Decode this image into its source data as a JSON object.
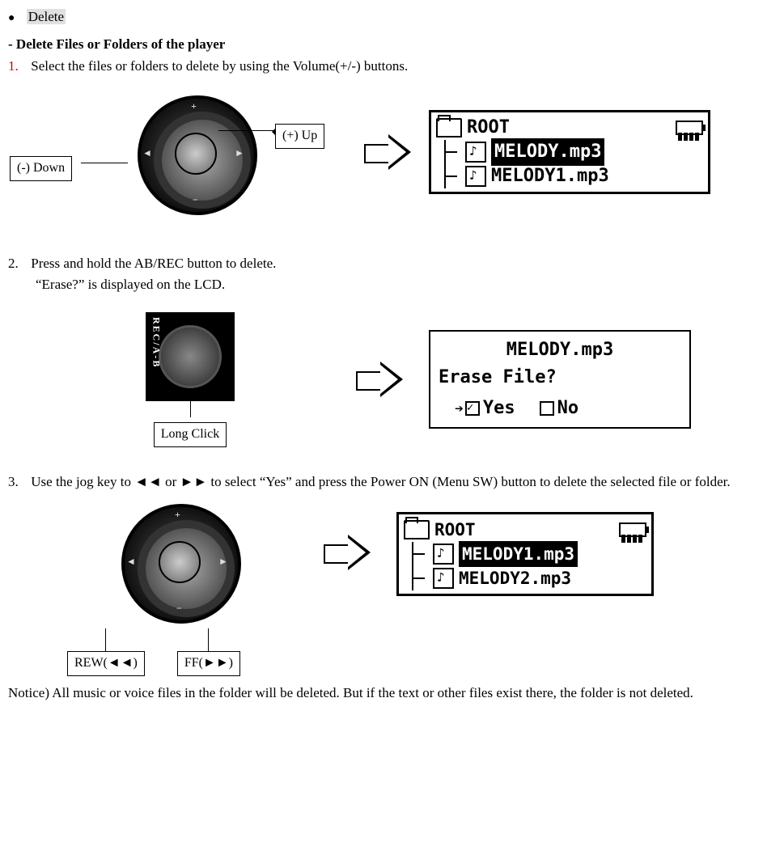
{
  "heading_bullet": "Delete",
  "subheading": "- Delete Files or Folders of the player",
  "step1_num": "1.",
  "step1_text": "Select the files or folders to delete by using the Volume(+/-) buttons.",
  "callout_up": "(+) Up",
  "callout_down": "(-) Down",
  "lcd1_root": "ROOT",
  "lcd1_item1": "MELODY.mp3",
  "lcd1_item2": "MELODY1.mp3",
  "step2_num": "2.",
  "step2_text": "Press and hold the AB/REC button to delete.",
  "step2_sub": "“Erase?” is displayed on the LCD.",
  "rec_side": "REC/A-B",
  "callout_long": "Long Click",
  "erase_title": "MELODY.mp3",
  "erase_q": "Erase File?",
  "erase_yes": "Yes",
  "erase_no": "No",
  "step3_num": "3.",
  "step3_text": "Use the jog key to ◄◄ or ►► to select “Yes” and press the Power ON (Menu SW) button to delete the selected file or folder.",
  "callout_rew": "REW(◄◄)",
  "callout_ff": "FF(►►)",
  "lcd2_root": "ROOT",
  "lcd2_item1": "MELODY1.mp3",
  "lcd2_item2": "MELODY2.mp3",
  "notice": "Notice) All music or voice files in the folder will be deleted. But if the text or other files exist there, the folder is not deleted."
}
